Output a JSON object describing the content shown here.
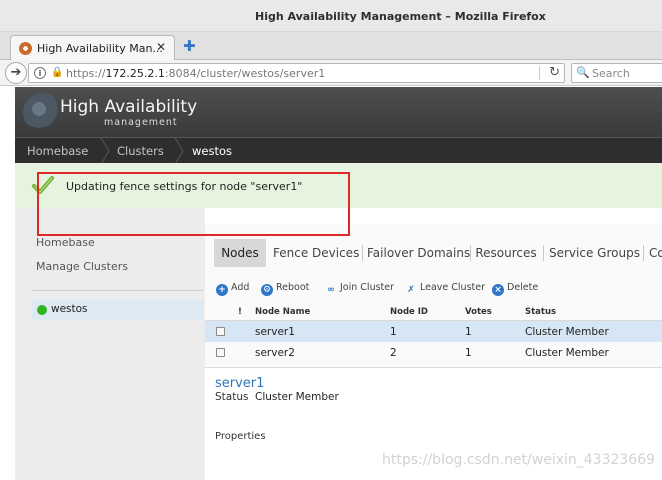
{
  "window": {
    "title": "High Availability Management – Mozilla Firefox"
  },
  "browser": {
    "tab_label": "High Availability Man...",
    "tab_close": "✕",
    "new_tab": "✚",
    "url_host": "172.25.2.1",
    "url_prefix": "https://",
    "url_rest": ":8084/cluster/westos/server1",
    "search_placeholder": "Search"
  },
  "header": {
    "title": "High Availability",
    "subtitle": "management"
  },
  "breadcrumb": [
    "Homebase",
    "Clusters",
    "westos"
  ],
  "notification": {
    "message": "Updating fence settings for node \"server1\"",
    "accent": "#e02626"
  },
  "sidebar": {
    "links": [
      "Homebase",
      "Manage Clusters"
    ],
    "clusters": [
      {
        "name": "westos",
        "status_color": "#2fb424"
      }
    ]
  },
  "tabs": [
    "Nodes",
    "Fence Devices",
    "Failover Domains",
    "Resources",
    "Service Groups",
    "Co"
  ],
  "active_tab": "Nodes",
  "toolbar": [
    {
      "label": "Add",
      "icon": "add-icon"
    },
    {
      "label": "Reboot",
      "icon": "gear-icon"
    },
    {
      "label": "Join Cluster",
      "icon": "link-icon"
    },
    {
      "label": "Leave Cluster",
      "icon": "unlink-icon"
    },
    {
      "label": "Delete",
      "icon": "delete-icon"
    }
  ],
  "table": {
    "headers": [
      "!",
      "Node Name",
      "Node ID",
      "Votes",
      "Status"
    ],
    "rows": [
      {
        "name": "server1",
        "id": "1",
        "votes": "1",
        "status": "Cluster Member",
        "selected": true
      },
      {
        "name": "server2",
        "id": "2",
        "votes": "1",
        "status": "Cluster Member",
        "selected": false
      }
    ]
  },
  "detail": {
    "node_name": "server1",
    "status_label": "Status",
    "status_value": "Cluster Member",
    "properties_label": "Properties"
  },
  "watermark": "https://blog.csdn.net/weixin_43323669"
}
